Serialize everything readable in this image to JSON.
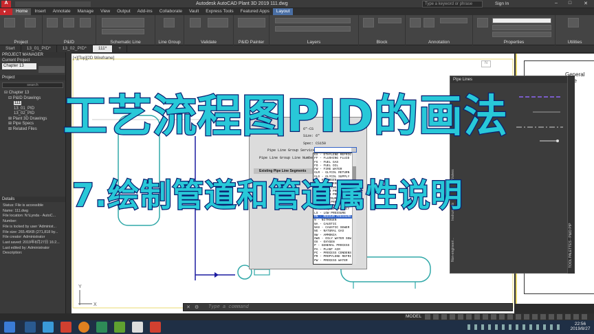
{
  "window": {
    "title": "Autodesk AutoCAD Plant 3D 2019    111.dwg",
    "search_placeholder": "Type a keyword or phrase",
    "sign_in": "Sign In"
  },
  "ribbon_tabs": [
    "Home",
    "Insert",
    "Annotate",
    "Manage",
    "View",
    "Output",
    "Add-ins",
    "Collaborate",
    "Vault",
    "Express Tools",
    "Featured Apps",
    "Layout"
  ],
  "ribbon_groups": [
    "Project",
    "P&ID",
    "Schematic Line",
    "Line Group",
    "Validate",
    "P&ID Painter",
    "Layers",
    "Block",
    "Annotation",
    "Properties",
    "Utilities"
  ],
  "doc_tabs": [
    "Start",
    "13_01_PID*",
    "13_02_PID*",
    "111*"
  ],
  "project_manager": {
    "title": "PROJECT MANAGER",
    "current_project_label": "Current Project",
    "current_project": "Chapter 13",
    "panel_label": "Project",
    "search_label": "search",
    "tree": [
      "Chapter 13",
      "P&ID Drawings",
      "111",
      "13_01_PID",
      "13_02_PID",
      "Plant 3D Drawings",
      "Pipe Specs",
      "Related Files"
    ]
  },
  "details": {
    "title": "Details",
    "lines": [
      "Status: File is accessible",
      "Name: 111.dwg",
      "File location: N:\\Lynda - AutoC...",
      "Number:",
      "File is locked by user 'Administ...",
      "File size: 265.45KB (271,818 by...",
      "File creator: Administrator",
      "Last saved: 2019年8月27日 16:2...",
      "Last edited by: Administrator",
      "Description:"
    ]
  },
  "canvas": {
    "viewport_label": "[+][Top][2D Wireframe]",
    "note": "General Note"
  },
  "tool_palette": {
    "tab": "Pipe Lines",
    "side_label": "TOOL PALETTES - P&ID PIP",
    "side_tabs": [
      "Valves",
      "Instruments",
      "Non-engineeri..."
    ]
  },
  "dialog": {
    "size_label": "Size:",
    "size_value": "6\"",
    "spec_label": "Spec:",
    "spec_value": "CS150",
    "service_label": "Pipe Line Group Service:",
    "number_label": "Pipe Line Group Line Number:",
    "segments_label": "Existing Pipe Line Segments",
    "tag_value": "6\"-CS",
    "options": [
      "EX - ETHYLENE REFRIG",
      "FF - FLUSHING FLUID",
      "FG - FUEL GAS",
      "FO - FUEL OIL",
      "FW - FIRE WATER",
      "GLR - GLYCOL RETURN",
      "GLS - GLYCOL SUPPLY",
      "H - HYDROGEN",
      "HF - HOT FEED",
      "HM - HEATING MEDIUM",
      "HN - HIGH PRESSURE",
      "HS - HIGH PRESSURE",
      "IA - INSTRUMENT AIR",
      "LN - LOW PRESSURE",
      "LO - LUBE OIL",
      "LP - LIQUID PRODUCT",
      "LS - LOW PRESSURE",
      "MN - MEDIUM PRESSURE",
      "N - NITROGEN",
      "NA - CAUSTIC",
      "NAS - CAUSTIC SEWER",
      "NG - NATURAL GAS",
      "NW - AMMONIA",
      "OWS - OILY WATER SEW",
      "OX - OXYGEN",
      "P - GENERAL PROCESS",
      "PA - PLANT AIR",
      "PC - PROCESS CONDENS",
      "PR - PROPYLENE REFRI",
      "PW - PROCESS WATER"
    ],
    "selected_index": 17
  },
  "overlay": {
    "line1": "工艺流程图PID的画法",
    "line2": "7.绘制管道和管道属性说明"
  },
  "command": {
    "placeholder": "Type a command"
  },
  "status": {
    "model": "MODEL"
  },
  "clock": {
    "time": "22:56",
    "date": "2019/8/27"
  },
  "axis": {
    "x": "X",
    "y": "Y"
  },
  "colors": {
    "overlay_fill": "#28c8d8",
    "overlay_stroke": "#0a2070",
    "pipe": "#1a1aa0",
    "equipment": "#30a8a8"
  }
}
